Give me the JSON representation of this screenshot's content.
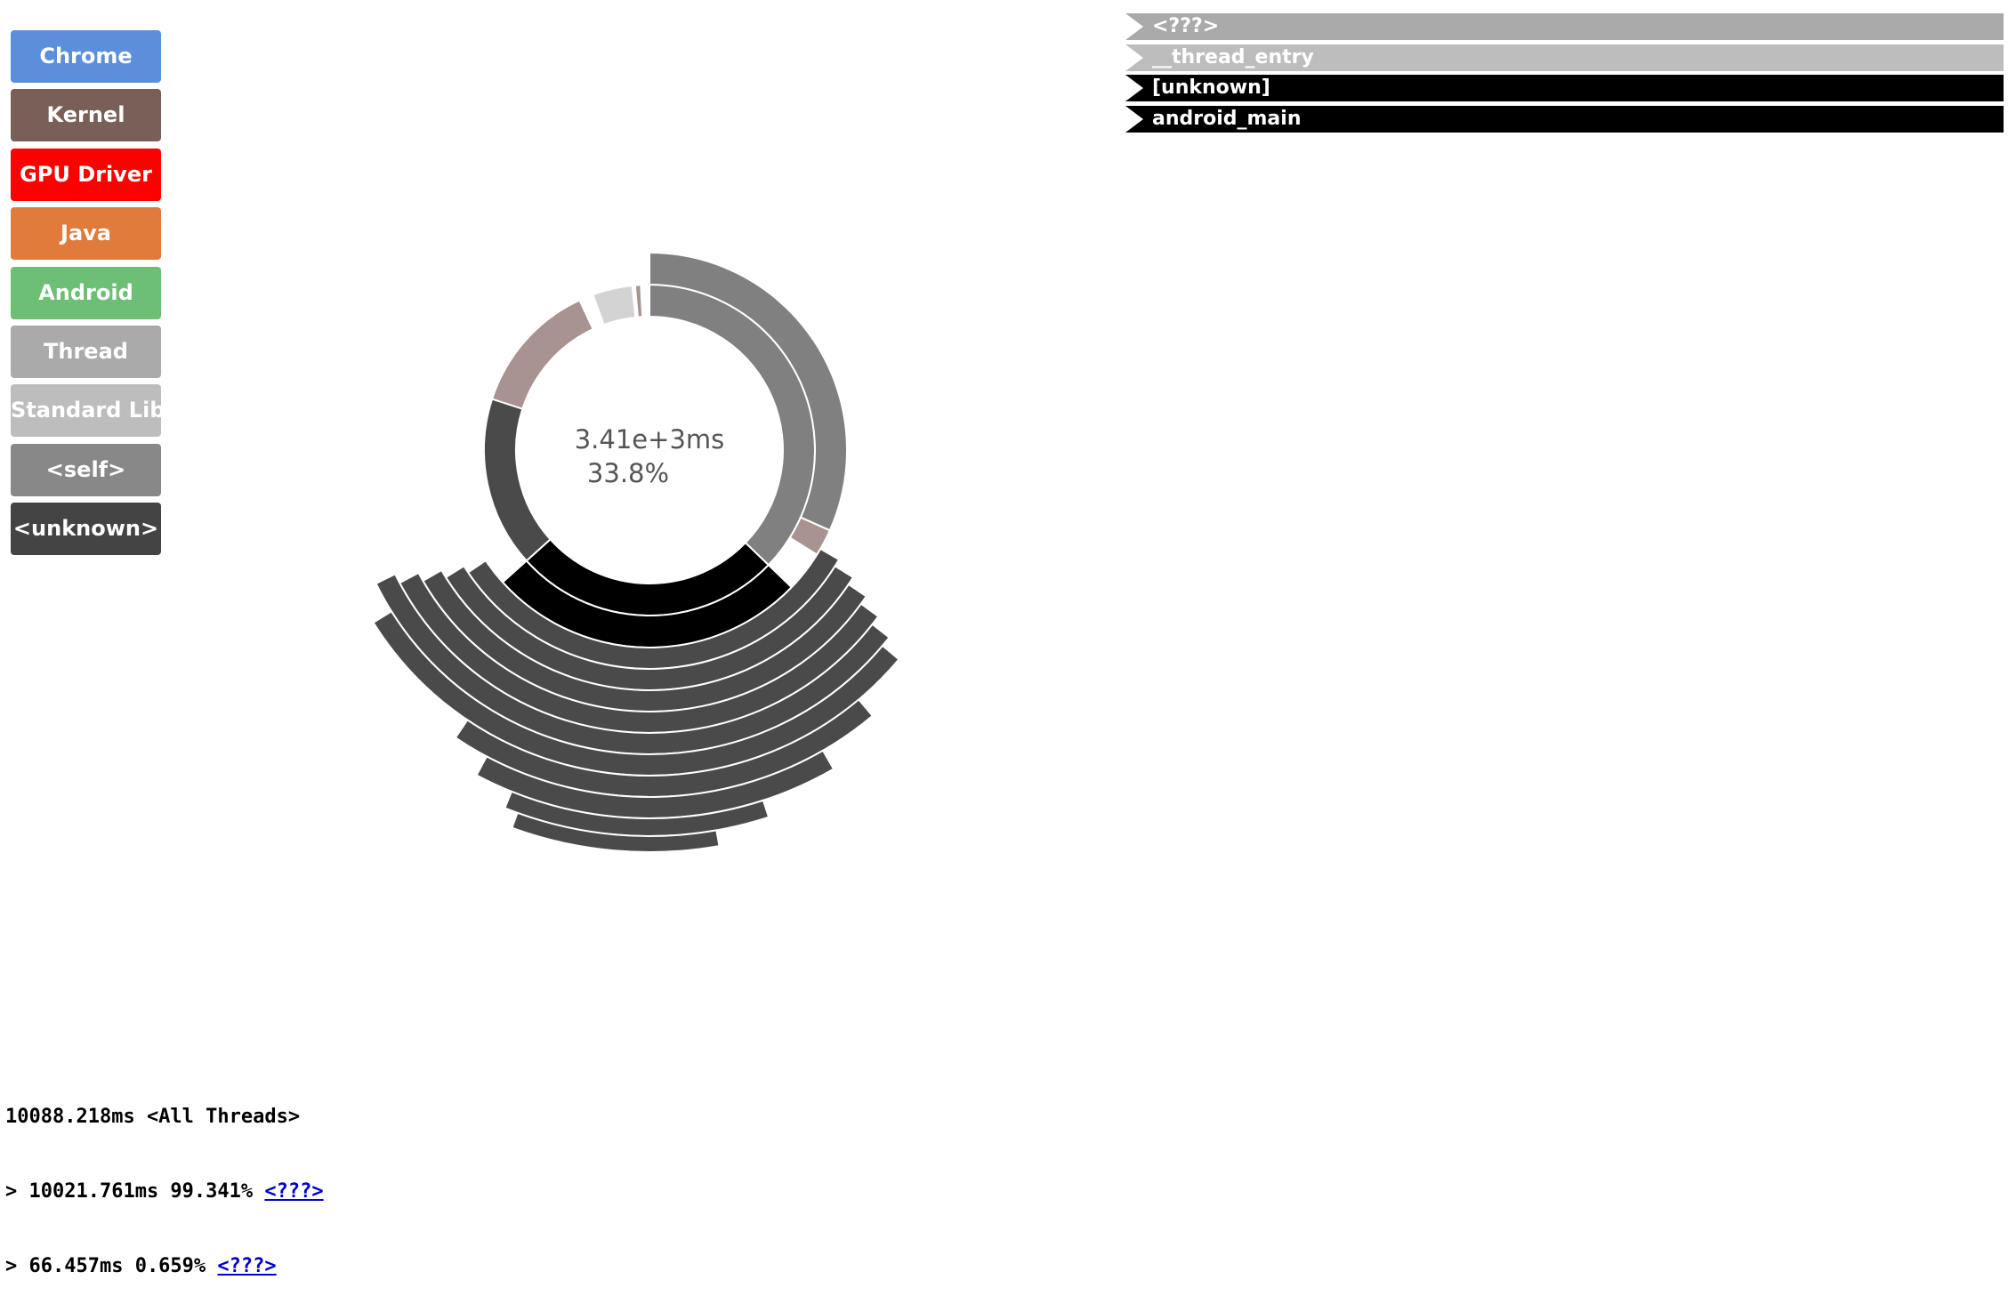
{
  "legend": {
    "items": [
      {
        "label": "Chrome",
        "color": "#5b8fdc"
      },
      {
        "label": "Kernel",
        "color": "#7a5f58"
      },
      {
        "label": "GPU Driver",
        "color": "#ff0000"
      },
      {
        "label": "Java",
        "color": "#e07b3b"
      },
      {
        "label": "Android",
        "color": "#6cbf74"
      },
      {
        "label": "Thread",
        "color": "#aaaaaa"
      },
      {
        "label": "Standard Lib",
        "color": "#bdbdbd"
      },
      {
        "label": "<self>",
        "color": "#888888"
      },
      {
        "label": "<unknown>",
        "color": "#444444"
      }
    ]
  },
  "breadcrumb": {
    "items": [
      {
        "label": "<???>",
        "color": "#aaaaaa"
      },
      {
        "label": "__thread_entry",
        "color": "#bdbdbd"
      },
      {
        "label": "[unknown]",
        "color": "#000000"
      },
      {
        "label": "android_main",
        "color": "#000000"
      }
    ]
  },
  "sunburst": {
    "center_value": "3.41e+3ms",
    "center_percent": "33.8%",
    "colors": {
      "thread": "#aaaaaa",
      "self": "#808080",
      "unknown": "#4a4a4a",
      "black": "#000000",
      "kernel_light": "#a89390",
      "stdlib_light": "#d3d3d3"
    }
  },
  "summary": {
    "total_line": "10088.218ms <All Threads>",
    "rows": [
      {
        "prefix": "> 10021.761ms 99.341% ",
        "link": "<???>"
      },
      {
        "prefix": "> 66.457ms 0.659% ",
        "link": "<???>"
      }
    ]
  }
}
